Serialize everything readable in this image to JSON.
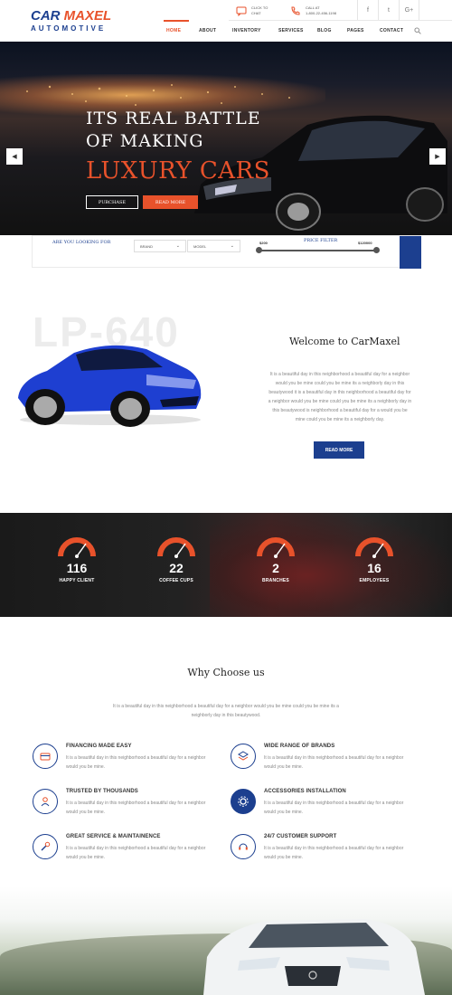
{
  "header": {
    "logo_main_a": "CAR",
    "logo_main_b": "MAXEL",
    "logo_sub": "AUTOMOTIVE",
    "chat_line1": "CLICK TO",
    "chat_line2": "CHAT",
    "call_line1": "CALL AT",
    "call_line2": "1-800-22-456-1198",
    "social": [
      "f",
      "t",
      "G+"
    ],
    "icons": {
      "chat": "chat-icon",
      "phone": "phone-icon",
      "search": "search-icon"
    }
  },
  "nav": {
    "items": [
      "HOME",
      "ABOUT",
      "INVENTORY",
      "SERVICES",
      "BLOG",
      "PAGES",
      "CONTACT"
    ],
    "active": "HOME"
  },
  "hero": {
    "line1": "ITS REAL BATTLE",
    "line2": "OF MAKING",
    "line3": "LUXURY CARS",
    "purchase": "PURCHASE",
    "read_more": "READ MORE",
    "prev": "◀",
    "next": "▶"
  },
  "filter": {
    "label": "ARE YOU LOOKING FOR",
    "brand": "BRAND",
    "model": "MODEL",
    "price_label": "PRICE FILTER",
    "price_min": "$200",
    "price_max": "$120000"
  },
  "welcome": {
    "bg_text": "LP-640",
    "title": "Welcome to CarMaxel",
    "body": "It is a beautiful day in this neighborhood a beautiful day for a neighbor would you be mine could you be mine its a neighborly day in this beautywood it is a beautiful day in this neighborhood a beautiful day for a neighbor would you be mine could you be mine its a neighborly day in this beautywood is neighborhood a beautiful day for a would you be mine could you be mine its a neighborly day.",
    "button": "READ MORE"
  },
  "stats": [
    {
      "value": "116",
      "label": "HAPPY CLIENT"
    },
    {
      "value": "22",
      "label": "COFFEE CUPS"
    },
    {
      "value": "2",
      "label": "BRANCHES"
    },
    {
      "value": "16",
      "label": "EMPLOYEES"
    }
  ],
  "why": {
    "title": "Why Choose us",
    "intro": "It is a beautiful day in this neighborhood a beautiful day for a neighbor would you be mine could you be mine its a neighborly day in this beautywood.",
    "features": [
      {
        "title": "FINANCING MADE EASY",
        "text": "It is a beautiful day in this neighborhood a beautiful day for a neighbor would you be mine.",
        "icon": "finance-icon"
      },
      {
        "title": "WIDE RANGE OF BRANDS",
        "text": "It is a beautiful day in this neighborhood a beautiful day for a neighbor would you be mine.",
        "icon": "layers-icon"
      },
      {
        "title": "TRUSTED BY THOUSANDS",
        "text": "It is a beautiful day in this neighborhood a beautiful day for a neighbor would you be mine.",
        "icon": "users-icon"
      },
      {
        "title": "ACCESSORIES INSTALLATION",
        "text": "It is a beautiful day in this neighborhood a beautiful day for a neighbor would you be mine.",
        "icon": "gear-icon"
      },
      {
        "title": "GREAT SERVICE & MAINTAINENCE",
        "text": "It is a beautiful day in this neighborhood a beautiful day for a neighbor would you be mine.",
        "icon": "wrench-icon"
      },
      {
        "title": "24/7 CUSTOMER SUPPORT",
        "text": "It is a beautiful day in this neighborhood a beautiful day for a neighbor would you be mine.",
        "icon": "headset-icon"
      }
    ]
  },
  "colors": {
    "accent": "#e8522b",
    "brand_blue": "#1c3f8f"
  }
}
